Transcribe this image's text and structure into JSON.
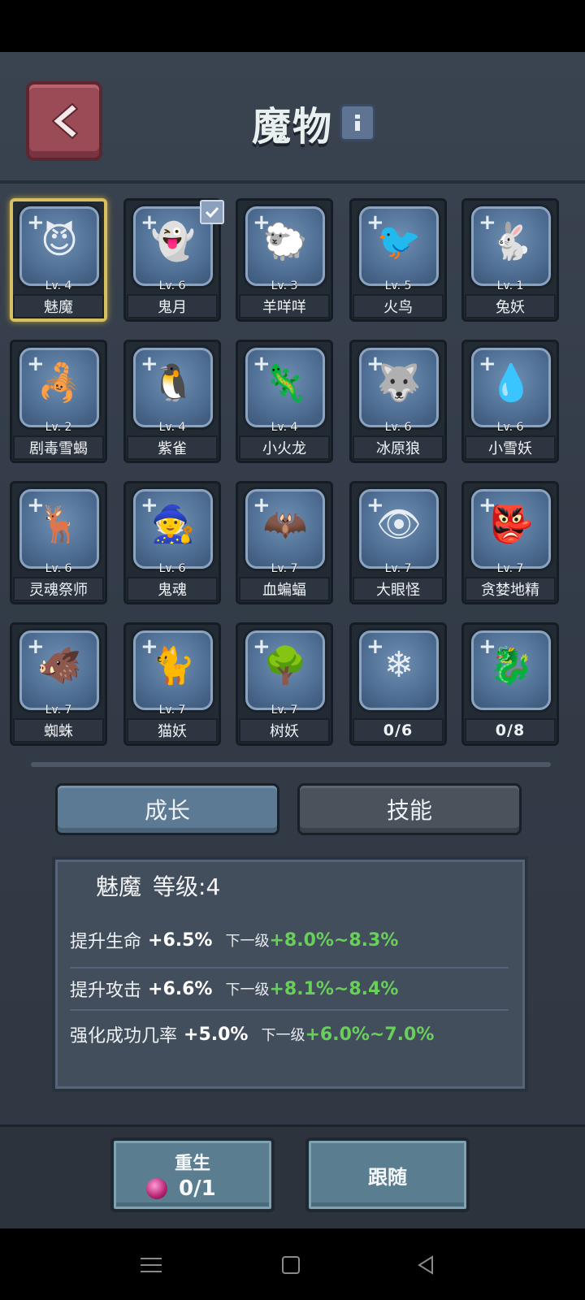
{
  "header": {
    "title": "魔物",
    "back_icon": "chevron-left-icon",
    "info_icon": "info-icon"
  },
  "monsters": [
    {
      "level": "Lv. 4",
      "name": "魅魔",
      "sprite": "😈",
      "selected": true
    },
    {
      "level": "Lv. 6",
      "name": "鬼月",
      "sprite": "👻",
      "checked": true
    },
    {
      "level": "Lv. 3",
      "name": "羊咩咩",
      "sprite": "🐑"
    },
    {
      "level": "Lv. 5",
      "name": "火鸟",
      "sprite": "🐦"
    },
    {
      "level": "Lv. 1",
      "name": "兔妖",
      "sprite": "🐇"
    },
    {
      "level": "Lv. 2",
      "name": "剧毒雪蝎",
      "sprite": "🦂"
    },
    {
      "level": "Lv. 4",
      "name": "紫雀",
      "sprite": "🐧"
    },
    {
      "level": "Lv. 4",
      "name": "小火龙",
      "sprite": "🦎"
    },
    {
      "level": "Lv. 6",
      "name": "冰原狼",
      "sprite": "🐺"
    },
    {
      "level": "Lv. 6",
      "name": "小雪妖",
      "sprite": "💧"
    },
    {
      "level": "Lv. 6",
      "name": "灵魂祭师",
      "sprite": "🦌"
    },
    {
      "level": "Lv. 6",
      "name": "鬼魂",
      "sprite": "🧙"
    },
    {
      "level": "Lv. 7",
      "name": "血蝙蝠",
      "sprite": "🦇"
    },
    {
      "level": "Lv. 7",
      "name": "大眼怪",
      "sprite": "👁"
    },
    {
      "level": "Lv. 7",
      "name": "贪婪地精",
      "sprite": "👺"
    },
    {
      "level": "Lv. 7",
      "name": "蜘蛛",
      "sprite": "🐗"
    },
    {
      "level": "Lv. 7",
      "name": "猫妖",
      "sprite": "🐈"
    },
    {
      "level": "Lv. 7",
      "name": "树妖",
      "sprite": "🌳"
    },
    {
      "level": "",
      "name": "0/6",
      "sprite": "❄",
      "locked": true
    },
    {
      "level": "",
      "name": "0/8",
      "sprite": "🐉",
      "locked": true
    }
  ],
  "tabs": {
    "growth": "成长",
    "skills": "技能"
  },
  "stats": {
    "monster_name": "魅魔",
    "level_text": "等级:4",
    "rows": [
      {
        "label": "提升生命",
        "value": "+6.5%",
        "next_label": "下一级",
        "next_value": "+8.0%~8.3%"
      },
      {
        "label": "提升攻击",
        "value": "+6.6%",
        "next_label": "下一级",
        "next_value": "+8.1%~8.4%"
      },
      {
        "label": "强化成功几率",
        "value": "+5.0%",
        "next_label": "下一级",
        "next_value": "+6.0%~7.0%"
      }
    ]
  },
  "bottom": {
    "rebirth_label": "重生",
    "rebirth_count": "0/1",
    "follow_label": "跟随"
  },
  "colors": {
    "accent_green": "#68d05a",
    "selected_gold": "#d8c060"
  }
}
